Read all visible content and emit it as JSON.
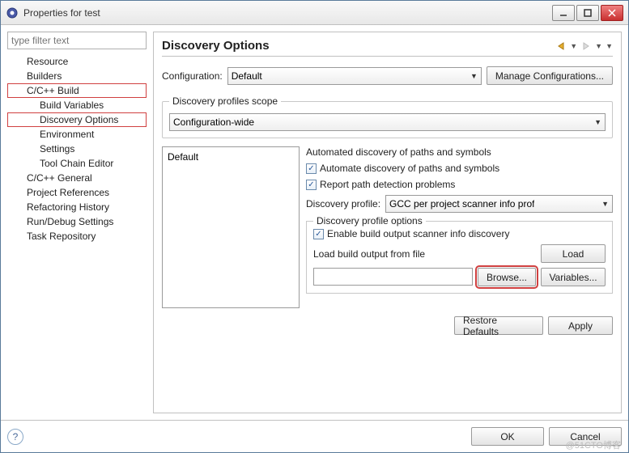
{
  "window": {
    "title": "Properties for test"
  },
  "filter": {
    "placeholder": "type filter text"
  },
  "tree": {
    "resource": "Resource",
    "builders": "Builders",
    "ccbuild": "C/C++ Build",
    "build_vars": "Build Variables",
    "discovery": "Discovery Options",
    "environment": "Environment",
    "settings": "Settings",
    "toolchain": "Tool Chain Editor",
    "ccgeneral": "C/C++ General",
    "projrefs": "Project References",
    "refhistory": "Refactoring History",
    "rundebug": "Run/Debug Settings",
    "taskrepo": "Task Repository"
  },
  "page": {
    "title": "Discovery Options",
    "config_label": "Configuration:",
    "config_value": "Default",
    "manage_btn": "Manage Configurations...",
    "scope_title": "Discovery profiles scope",
    "scope_value": "Configuration-wide",
    "list_item": "Default",
    "auto_title": "Automated discovery of paths and symbols",
    "chk_auto": "Automate discovery of paths and symbols",
    "chk_report": "Report path detection problems",
    "profile_label": "Discovery profile:",
    "profile_value": "GCC per project scanner info prof",
    "subgroup_title": "Discovery profile options",
    "chk_enable": "Enable build output scanner info discovery",
    "load_label": "Load build output from file",
    "load_btn": "Load",
    "browse_btn": "Browse...",
    "vars_btn": "Variables...",
    "restore_btn": "Restore Defaults",
    "apply_btn": "Apply"
  },
  "footer": {
    "ok": "OK",
    "cancel": "Cancel"
  },
  "watermark": "@51CTO博客"
}
